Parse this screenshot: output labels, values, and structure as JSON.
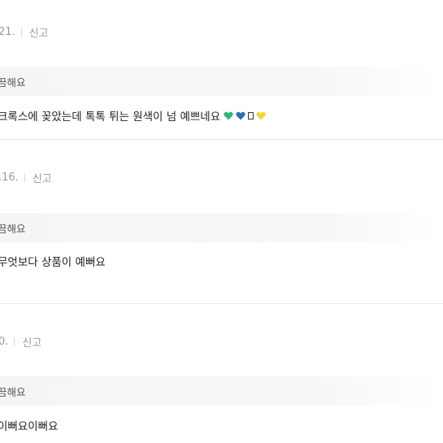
{
  "reviews": [
    {
      "date": "21.",
      "report_label": "신고",
      "option": "끔해요",
      "text": "크록스에 꽂았는데 톡톡 튀는 원색이 넘 예쁘네요",
      "emoji": [
        "green-heart",
        "blue-heart",
        "missing-glyph",
        "yellow-heart"
      ],
      "colors": {
        "green": "#2fb57a",
        "blue": "#2b6fb5",
        "yellow": "#f2d338"
      }
    },
    {
      "date": ".16.",
      "report_label": "신고",
      "option": "끔해요",
      "text": "무엇보다 상품이 예뻐요"
    },
    {
      "date": "0.",
      "report_label": "신고",
      "option": "끔해요",
      "text": "이뻐요이뻐요"
    }
  ]
}
